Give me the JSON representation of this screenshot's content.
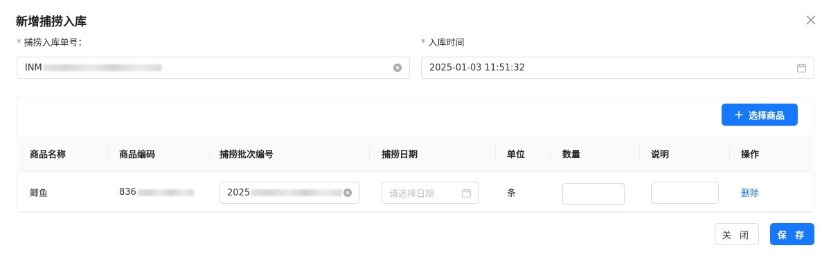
{
  "dialog": {
    "title": "新增捕捞入库",
    "close_icon": "close-icon"
  },
  "form": {
    "order_no": {
      "required_mark": "*",
      "label": "捕捞入库单号：",
      "value_prefix": "INM",
      "value_redacted": true,
      "clear_icon": "clear-circle-icon"
    },
    "entry_time": {
      "required_mark": "*",
      "label": "入库时间",
      "value": "2025-01-03 11:51:32",
      "calendar_icon": "calendar-icon"
    }
  },
  "toolbar": {
    "select_product_label": "选择商品",
    "plus_icon": "plus-icon"
  },
  "table": {
    "columns": [
      "商品名称",
      "商品编码",
      "捕捞批次编号",
      "捕捞日期",
      "单位",
      "数量",
      "说明",
      "操作"
    ],
    "rows": [
      {
        "name": "鲫鱼",
        "code_prefix": "836",
        "code_redacted": true,
        "batch_prefix": "2025",
        "batch_redacted": true,
        "date_placeholder": "请选择日期",
        "unit": "条",
        "quantity": "",
        "note": "",
        "action": "删除"
      }
    ]
  },
  "footer": {
    "close_label": "关 闭",
    "save_label": "保 存"
  },
  "colors": {
    "primary": "#1677ff",
    "required": "#f56c6c",
    "border": "#dcdfe6",
    "header_bg": "#fafafa"
  }
}
